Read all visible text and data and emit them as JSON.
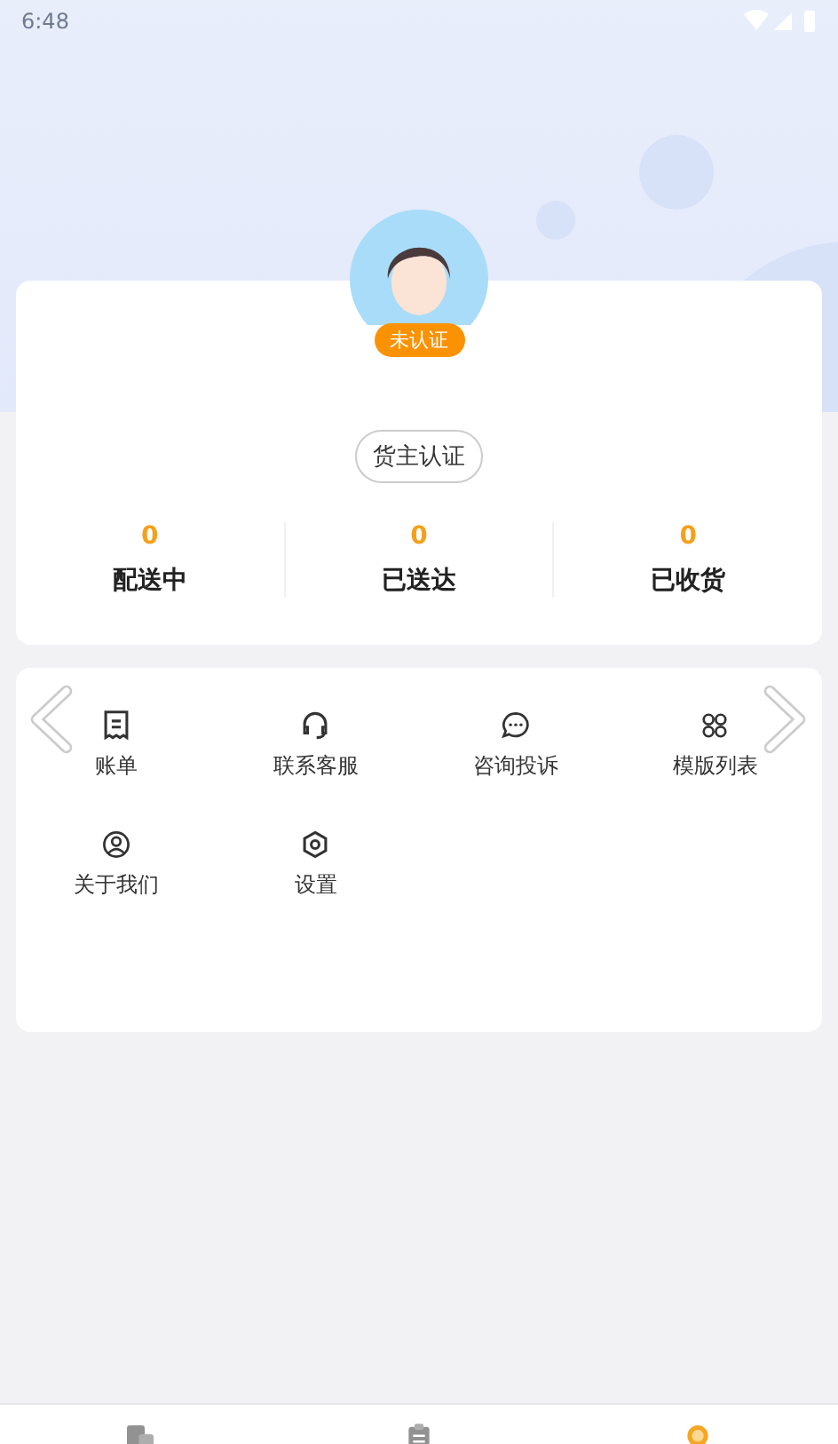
{
  "status_bar": {
    "time": "6:48"
  },
  "profile": {
    "badge": "未认证",
    "certify_button": "货主认证"
  },
  "stats": [
    {
      "value": "0",
      "label": "配送中"
    },
    {
      "value": "0",
      "label": "已送达"
    },
    {
      "value": "0",
      "label": "已收货"
    }
  ],
  "menu": {
    "items": [
      {
        "label": "账单"
      },
      {
        "label": "联系客服"
      },
      {
        "label": "咨询投诉"
      },
      {
        "label": "模版列表"
      },
      {
        "label": "关于我们"
      },
      {
        "label": "设置"
      }
    ]
  },
  "bottom_nav": [
    {
      "selected": false
    },
    {
      "selected": false
    },
    {
      "selected": true
    }
  ]
}
